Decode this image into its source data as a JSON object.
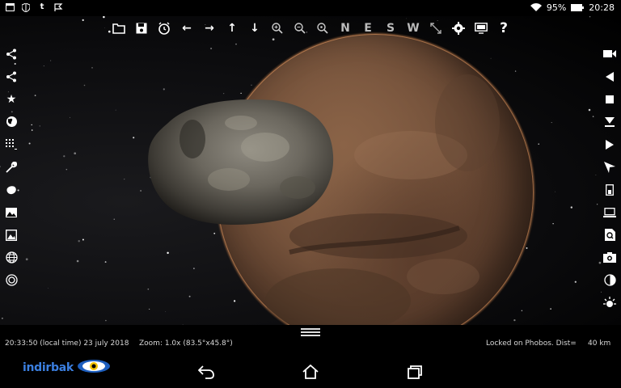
{
  "status_bar": {
    "battery": "95%",
    "time": "20:28",
    "left_icons": [
      "window-icon",
      "shield-icon",
      "tumblr-icon",
      "check-flag-icon"
    ]
  },
  "toolbar_top": [
    {
      "name": "open-folder-icon"
    },
    {
      "name": "save-icon"
    },
    {
      "name": "alarm-clock-icon"
    },
    {
      "name": "arrow-left-icon"
    },
    {
      "name": "arrow-right-icon"
    },
    {
      "name": "arrow-up-icon"
    },
    {
      "name": "arrow-down-icon"
    },
    {
      "name": "zoom-in-icon"
    },
    {
      "name": "zoom-out-icon"
    },
    {
      "name": "zoom-reset-icon"
    },
    {
      "name": "direction-north",
      "label": "N"
    },
    {
      "name": "direction-east",
      "label": "E"
    },
    {
      "name": "direction-south",
      "label": "S"
    },
    {
      "name": "direction-west",
      "label": "W"
    },
    {
      "name": "fullscreen-icon"
    },
    {
      "name": "settings-gear-icon"
    },
    {
      "name": "display-monitor-icon"
    },
    {
      "name": "help-icon",
      "label": "?"
    }
  ],
  "toolbar_left": [
    "share-icon",
    "share-alt-icon",
    "star-icon",
    "globe-icon",
    "grid-icon",
    "wrench-icon",
    "asteroid-icon",
    "image-icon",
    "image-frame-icon",
    "world-grid-icon",
    "target-icon"
  ],
  "toolbar_right": [
    "video-camera-icon",
    "play-reverse-icon",
    "stop-icon",
    "step-down-icon",
    "play-icon",
    "cursor-icon",
    "device-icon",
    "laptop-icon",
    "search-document-icon",
    "camera-icon",
    "contrast-icon",
    "brightness-icon"
  ],
  "info_bar": {
    "datetime": "20:33:50 (local time)  23 july 2018",
    "zoom": "Zoom: 1.0x (83.5°x45.8°)",
    "locked": "Locked on Phobos. Dist=",
    "distance": "40 km"
  },
  "brand": {
    "text": "indirbak"
  },
  "colors": {
    "brand": "#3b7fe0",
    "mars_rim": "#e6965a"
  }
}
